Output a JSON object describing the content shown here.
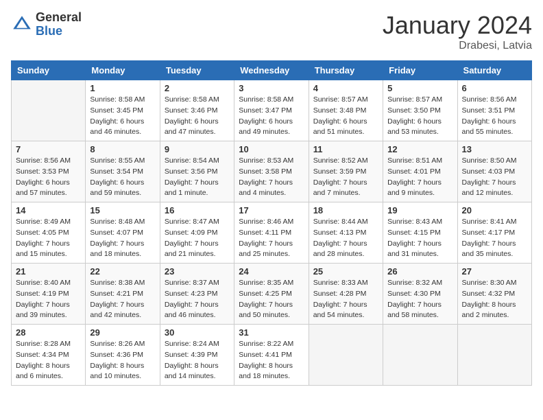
{
  "header": {
    "logo_general": "General",
    "logo_blue": "Blue",
    "month_title": "January 2024",
    "location": "Drabesi, Latvia"
  },
  "days_of_week": [
    "Sunday",
    "Monday",
    "Tuesday",
    "Wednesday",
    "Thursday",
    "Friday",
    "Saturday"
  ],
  "weeks": [
    [
      {
        "day": "",
        "sunrise": "",
        "sunset": "",
        "daylight": ""
      },
      {
        "day": "1",
        "sunrise": "Sunrise: 8:58 AM",
        "sunset": "Sunset: 3:45 PM",
        "daylight": "Daylight: 6 hours and 46 minutes."
      },
      {
        "day": "2",
        "sunrise": "Sunrise: 8:58 AM",
        "sunset": "Sunset: 3:46 PM",
        "daylight": "Daylight: 6 hours and 47 minutes."
      },
      {
        "day": "3",
        "sunrise": "Sunrise: 8:58 AM",
        "sunset": "Sunset: 3:47 PM",
        "daylight": "Daylight: 6 hours and 49 minutes."
      },
      {
        "day": "4",
        "sunrise": "Sunrise: 8:57 AM",
        "sunset": "Sunset: 3:48 PM",
        "daylight": "Daylight: 6 hours and 51 minutes."
      },
      {
        "day": "5",
        "sunrise": "Sunrise: 8:57 AM",
        "sunset": "Sunset: 3:50 PM",
        "daylight": "Daylight: 6 hours and 53 minutes."
      },
      {
        "day": "6",
        "sunrise": "Sunrise: 8:56 AM",
        "sunset": "Sunset: 3:51 PM",
        "daylight": "Daylight: 6 hours and 55 minutes."
      }
    ],
    [
      {
        "day": "7",
        "sunrise": "Sunrise: 8:56 AM",
        "sunset": "Sunset: 3:53 PM",
        "daylight": "Daylight: 6 hours and 57 minutes."
      },
      {
        "day": "8",
        "sunrise": "Sunrise: 8:55 AM",
        "sunset": "Sunset: 3:54 PM",
        "daylight": "Daylight: 6 hours and 59 minutes."
      },
      {
        "day": "9",
        "sunrise": "Sunrise: 8:54 AM",
        "sunset": "Sunset: 3:56 PM",
        "daylight": "Daylight: 7 hours and 1 minute."
      },
      {
        "day": "10",
        "sunrise": "Sunrise: 8:53 AM",
        "sunset": "Sunset: 3:58 PM",
        "daylight": "Daylight: 7 hours and 4 minutes."
      },
      {
        "day": "11",
        "sunrise": "Sunrise: 8:52 AM",
        "sunset": "Sunset: 3:59 PM",
        "daylight": "Daylight: 7 hours and 7 minutes."
      },
      {
        "day": "12",
        "sunrise": "Sunrise: 8:51 AM",
        "sunset": "Sunset: 4:01 PM",
        "daylight": "Daylight: 7 hours and 9 minutes."
      },
      {
        "day": "13",
        "sunrise": "Sunrise: 8:50 AM",
        "sunset": "Sunset: 4:03 PM",
        "daylight": "Daylight: 7 hours and 12 minutes."
      }
    ],
    [
      {
        "day": "14",
        "sunrise": "Sunrise: 8:49 AM",
        "sunset": "Sunset: 4:05 PM",
        "daylight": "Daylight: 7 hours and 15 minutes."
      },
      {
        "day": "15",
        "sunrise": "Sunrise: 8:48 AM",
        "sunset": "Sunset: 4:07 PM",
        "daylight": "Daylight: 7 hours and 18 minutes."
      },
      {
        "day": "16",
        "sunrise": "Sunrise: 8:47 AM",
        "sunset": "Sunset: 4:09 PM",
        "daylight": "Daylight: 7 hours and 21 minutes."
      },
      {
        "day": "17",
        "sunrise": "Sunrise: 8:46 AM",
        "sunset": "Sunset: 4:11 PM",
        "daylight": "Daylight: 7 hours and 25 minutes."
      },
      {
        "day": "18",
        "sunrise": "Sunrise: 8:44 AM",
        "sunset": "Sunset: 4:13 PM",
        "daylight": "Daylight: 7 hours and 28 minutes."
      },
      {
        "day": "19",
        "sunrise": "Sunrise: 8:43 AM",
        "sunset": "Sunset: 4:15 PM",
        "daylight": "Daylight: 7 hours and 31 minutes."
      },
      {
        "day": "20",
        "sunrise": "Sunrise: 8:41 AM",
        "sunset": "Sunset: 4:17 PM",
        "daylight": "Daylight: 7 hours and 35 minutes."
      }
    ],
    [
      {
        "day": "21",
        "sunrise": "Sunrise: 8:40 AM",
        "sunset": "Sunset: 4:19 PM",
        "daylight": "Daylight: 7 hours and 39 minutes."
      },
      {
        "day": "22",
        "sunrise": "Sunrise: 8:38 AM",
        "sunset": "Sunset: 4:21 PM",
        "daylight": "Daylight: 7 hours and 42 minutes."
      },
      {
        "day": "23",
        "sunrise": "Sunrise: 8:37 AM",
        "sunset": "Sunset: 4:23 PM",
        "daylight": "Daylight: 7 hours and 46 minutes."
      },
      {
        "day": "24",
        "sunrise": "Sunrise: 8:35 AM",
        "sunset": "Sunset: 4:25 PM",
        "daylight": "Daylight: 7 hours and 50 minutes."
      },
      {
        "day": "25",
        "sunrise": "Sunrise: 8:33 AM",
        "sunset": "Sunset: 4:28 PM",
        "daylight": "Daylight: 7 hours and 54 minutes."
      },
      {
        "day": "26",
        "sunrise": "Sunrise: 8:32 AM",
        "sunset": "Sunset: 4:30 PM",
        "daylight": "Daylight: 7 hours and 58 minutes."
      },
      {
        "day": "27",
        "sunrise": "Sunrise: 8:30 AM",
        "sunset": "Sunset: 4:32 PM",
        "daylight": "Daylight: 8 hours and 2 minutes."
      }
    ],
    [
      {
        "day": "28",
        "sunrise": "Sunrise: 8:28 AM",
        "sunset": "Sunset: 4:34 PM",
        "daylight": "Daylight: 8 hours and 6 minutes."
      },
      {
        "day": "29",
        "sunrise": "Sunrise: 8:26 AM",
        "sunset": "Sunset: 4:36 PM",
        "daylight": "Daylight: 8 hours and 10 minutes."
      },
      {
        "day": "30",
        "sunrise": "Sunrise: 8:24 AM",
        "sunset": "Sunset: 4:39 PM",
        "daylight": "Daylight: 8 hours and 14 minutes."
      },
      {
        "day": "31",
        "sunrise": "Sunrise: 8:22 AM",
        "sunset": "Sunset: 4:41 PM",
        "daylight": "Daylight: 8 hours and 18 minutes."
      },
      {
        "day": "",
        "sunrise": "",
        "sunset": "",
        "daylight": ""
      },
      {
        "day": "",
        "sunrise": "",
        "sunset": "",
        "daylight": ""
      },
      {
        "day": "",
        "sunrise": "",
        "sunset": "",
        "daylight": ""
      }
    ]
  ]
}
